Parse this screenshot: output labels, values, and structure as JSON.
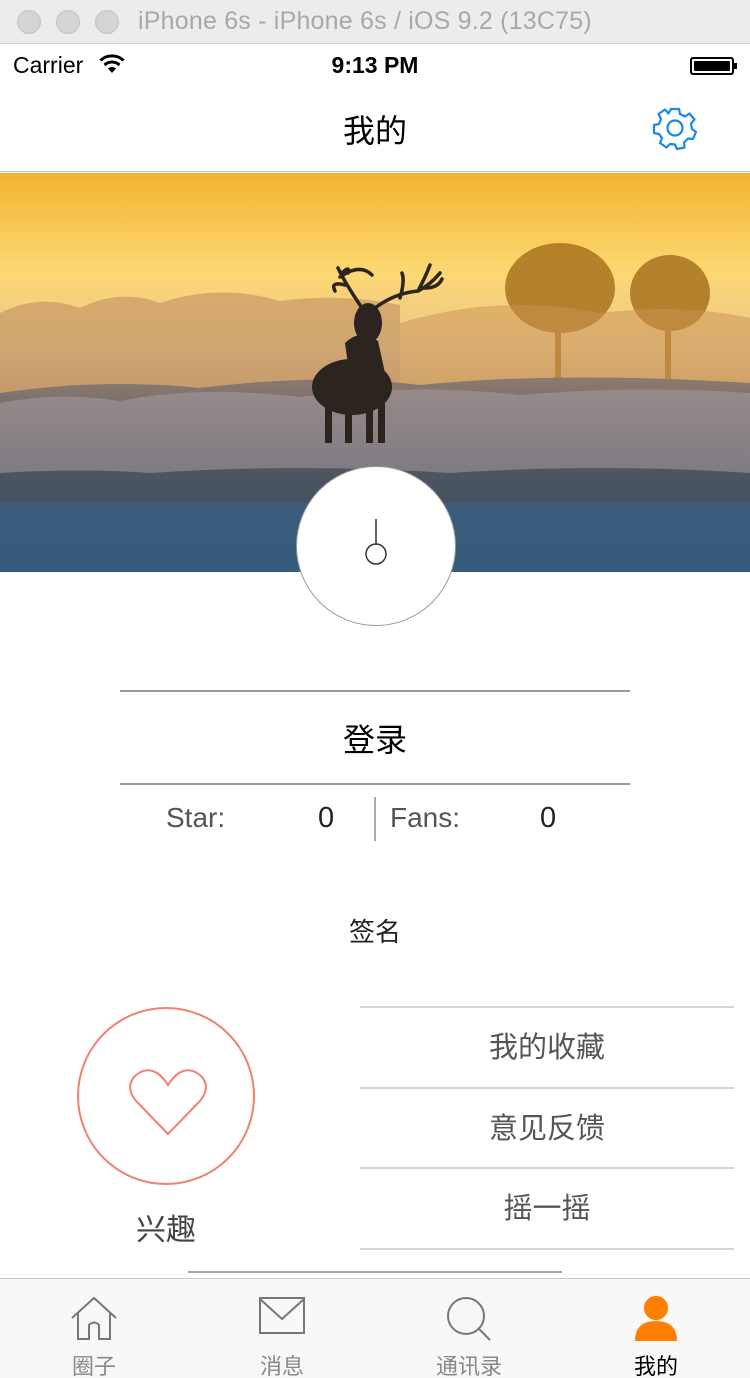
{
  "simulator": {
    "title": "iPhone 6s - iPhone 6s / iOS 9.2 (13C75)"
  },
  "status_bar": {
    "carrier": "Carrier",
    "time": "9:13 PM"
  },
  "nav": {
    "title": "我的",
    "settings_icon": "gear-icon"
  },
  "profile": {
    "login_label": "登录",
    "star_label": "Star:",
    "star_value": "0",
    "fans_label": "Fans:",
    "fans_value": "0",
    "signature": "签名"
  },
  "interest": {
    "label": "兴趣",
    "icon": "heart-icon"
  },
  "menu": [
    {
      "label": "我的收藏"
    },
    {
      "label": "意见反馈"
    },
    {
      "label": "摇一摇"
    }
  ],
  "tabs": [
    {
      "label": "圈子",
      "icon": "home-icon"
    },
    {
      "label": "消息",
      "icon": "mail-icon"
    },
    {
      "label": "通讯录",
      "icon": "search-icon"
    },
    {
      "label": "我的",
      "icon": "person-icon",
      "active": true
    }
  ],
  "colors": {
    "accent": "#ff8000",
    "ios_blue": "#1a86f0",
    "heart": "#f08070"
  }
}
